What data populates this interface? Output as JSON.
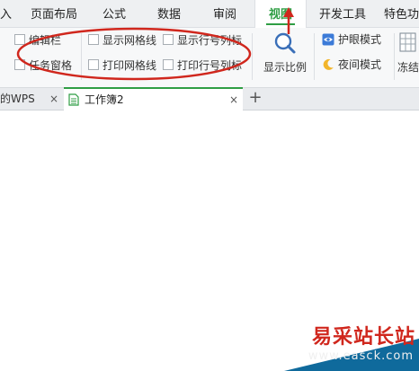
{
  "menu": {
    "tabs": [
      {
        "label": "入"
      },
      {
        "label": "页面布局"
      },
      {
        "label": "公式"
      },
      {
        "label": "数据"
      },
      {
        "label": "审阅"
      },
      {
        "label": "视图"
      },
      {
        "label": "开发工具"
      },
      {
        "label": "特色功"
      }
    ],
    "active_tab": "视图"
  },
  "ribbon": {
    "checkboxes": [
      {
        "label": "编辑栏",
        "checked": false
      },
      {
        "label": "任务窗格",
        "checked": false
      },
      {
        "label": "显示网格线",
        "checked": false
      },
      {
        "label": "打印网格线",
        "checked": false
      },
      {
        "label": "显示行号列标",
        "checked": false
      },
      {
        "label": "打印行号列标",
        "checked": false
      }
    ],
    "zoom_label": "显示比例",
    "eye_mode_label": "护眼模式",
    "night_mode_label": "夜间模式",
    "freeze_label": "冻结"
  },
  "documents": {
    "tabs": [
      {
        "label": "我的WPS",
        "close": "×"
      },
      {
        "label": "工作簿2",
        "close": "×"
      }
    ],
    "add": "+"
  },
  "watermark": {
    "text": "易采站长站",
    "url": "www.easck.com"
  },
  "colors": {
    "accent": "#2f9e44",
    "annotation": "#d0271d",
    "ribbon_bg": "#f7f8f9",
    "menubar_bg": "#eef0f2"
  },
  "icons": [
    "magnifier-icon",
    "eye-protection-icon",
    "moon-icon",
    "freeze-panes-icon",
    "sheet-icon",
    "close-icon",
    "plus-icon"
  ]
}
